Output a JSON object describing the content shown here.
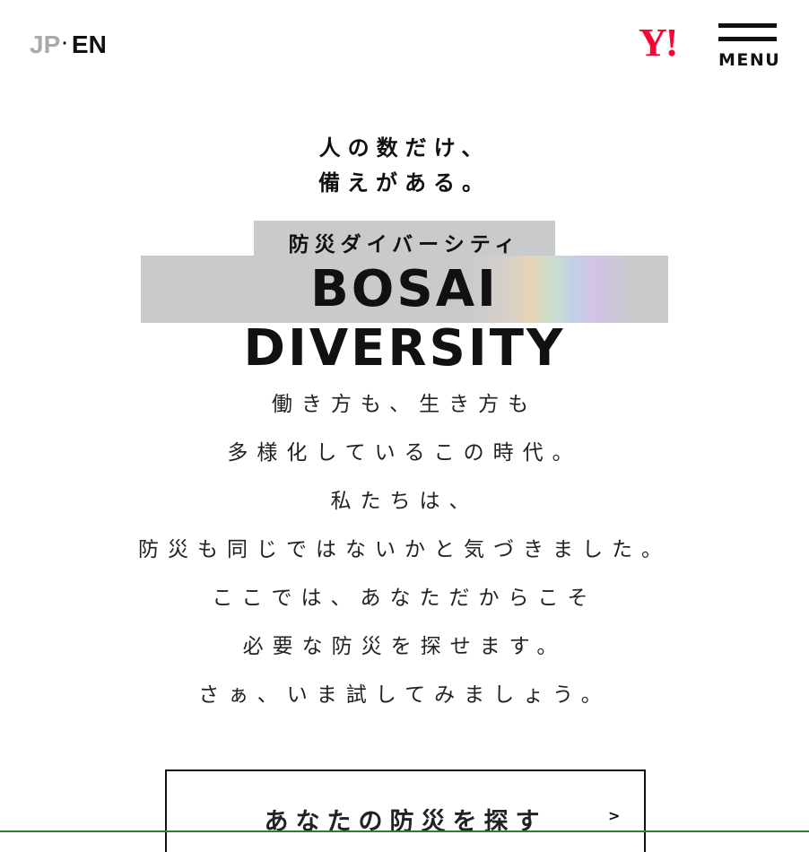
{
  "header": {
    "lang_jp": "JP",
    "lang_sep": "·",
    "lang_en": "EN",
    "logo_text": "Y!",
    "menu_label": "MENU",
    "logo_color": "#ff0033"
  },
  "hero": {
    "tagline_line1": "人の数だけ、",
    "tagline_line2": "備えがある。",
    "subtitle": "防災ダイバーシティ",
    "title": "BOSAI DIVERSITY"
  },
  "intro": {
    "lines": [
      "働き方も、生き方も",
      "多様化しているこの時代。",
      "私たちは、",
      "防災も同じではないかと気づきました。",
      "ここでは、あなただからこそ",
      "必要な防災を探せます。",
      "さぁ、いま試してみましょう。"
    ]
  },
  "cta": {
    "label": "あなたの防災を探す",
    "icon": "chevron-right-icon"
  }
}
